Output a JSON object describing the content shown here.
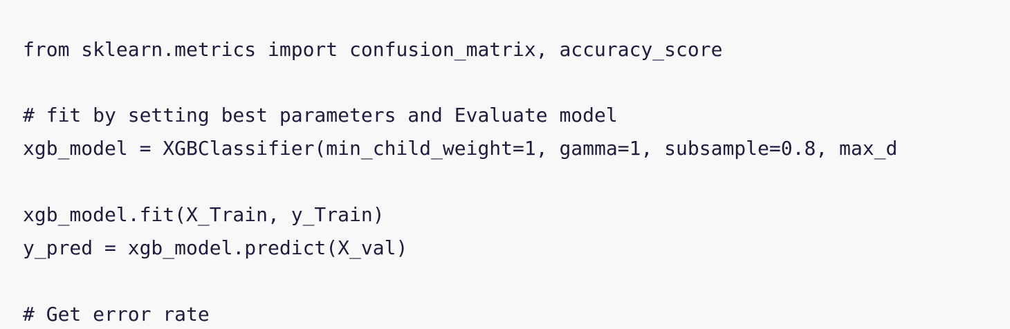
{
  "code": {
    "lines": [
      "from sklearn.metrics import confusion_matrix, accuracy_score",
      "# fit by setting best parameters and Evaluate model",
      "xgb_model = XGBClassifier(min_child_weight=1, gamma=1, subsample=0.8, max_d",
      "xgb_model.fit(X_Train, y_Train)",
      "y_pred = xgb_model.predict(X_val)",
      "# Get error rate"
    ]
  },
  "colors": {
    "background": "#f8f8f8",
    "text": "#1d1d3d"
  }
}
